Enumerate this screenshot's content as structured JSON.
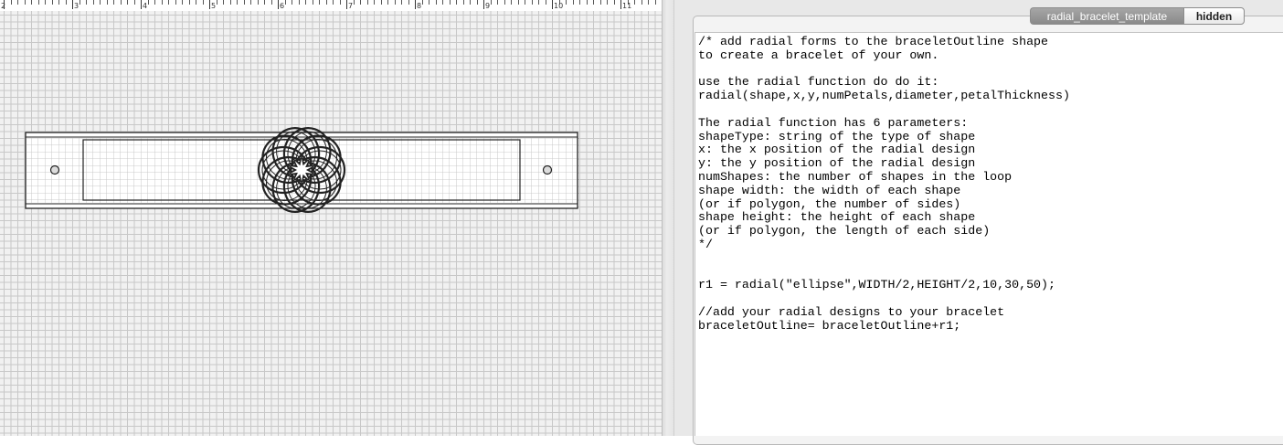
{
  "ruler": {
    "labels": [
      "2",
      "3",
      "4",
      "5",
      "6",
      "7",
      "8",
      "9",
      "10",
      "11"
    ]
  },
  "editor": {
    "tabs": [
      {
        "label": "radial_bracelet_template",
        "active": true
      },
      {
        "label": "hidden",
        "active": false
      }
    ],
    "code_lines": [
      "/* add radial forms to the braceletOutline shape",
      "to create a bracelet of your own.",
      "",
      "use the radial function do do it:",
      "radial(shape,x,y,numPetals,diameter,petalThickness)",
      "",
      "The radial function has 6 parameters:",
      "shapeType: string of the type of shape",
      "x: the x position of the radial design",
      "y: the y position of the radial design",
      "numShapes: the number of shapes in the loop",
      "shape width: the width of each shape",
      "(or if polygon, the number of sides)",
      "shape height: the height of each shape",
      "(or if polygon, the length of each side)",
      "*/",
      "",
      "",
      "r1 = radial(\"ellipse\",WIDTH/2,HEIGHT/2,10,30,50);",
      "",
      "//add your radial designs to your bracelet",
      "braceletOutline= braceletOutline+r1;"
    ]
  },
  "colors": {
    "grid_minor": "#c8c8c8",
    "grid_major": "#8f8f8f",
    "canvas_bg": "#f1f1f1",
    "tab_active_bg": "#999999",
    "tab_inactive_bg": "#ffffff"
  },
  "icons": {
    "left_hole": "hole-circle",
    "right_hole": "hole-circle",
    "radial_design": "radial-ellipse-flower"
  }
}
